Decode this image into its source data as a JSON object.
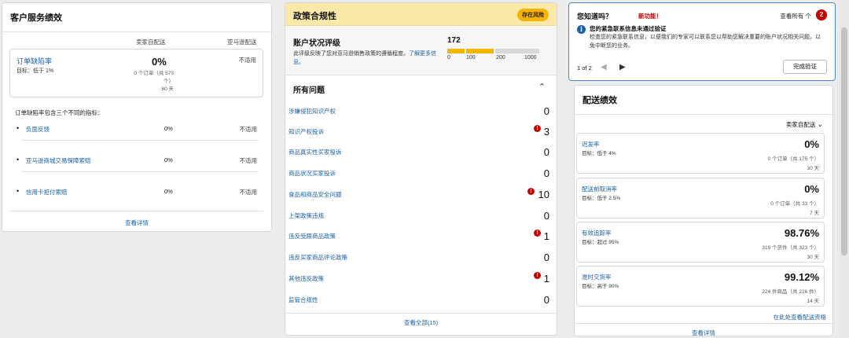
{
  "customer_service": {
    "title": "客户服务绩效",
    "col_seller": "卖家自配送",
    "col_amazon": "亚马逊配送",
    "odr": {
      "name": "订单缺陷率",
      "target": "目标：低于 1%",
      "value": "0%",
      "sub_line1": "0 个订单（共 573",
      "sub_line2": "个）",
      "days": "60 天",
      "amazon": "不适用"
    },
    "note": "订单缺陷率包含三个不同的指标：",
    "metrics": [
      {
        "name": "负面反馈",
        "value": "0%",
        "amazon": "不适用"
      },
      {
        "name": "亚马逊商城交易保障索赔",
        "value": "0%",
        "amazon": "不适用"
      },
      {
        "name": "信用卡拒付索赔",
        "value": "0%",
        "amazon": "不适用"
      }
    ],
    "view_details": "查看详情"
  },
  "policy": {
    "title": "政策合规性",
    "badge": "存在风险",
    "ahr_title": "账户状况评级",
    "ahr_desc": "此评级反映了您对亚马逊销售政策的遵循程度。",
    "ahr_link": "了解更多信息。",
    "score": "172",
    "ticks": [
      "0",
      "100",
      "200",
      "1000"
    ],
    "issues_title": "所有问题",
    "issues": [
      {
        "name": "涉嫌侵犯知识产权",
        "count": "0",
        "alert": false
      },
      {
        "name": "知识产权投诉",
        "count": "3",
        "alert": true
      },
      {
        "name": "商品真实性买家投诉",
        "count": "0",
        "alert": false
      },
      {
        "name": "商品状况买家投诉",
        "count": "0",
        "alert": false
      },
      {
        "name": "食品和商品安全问题",
        "count": "10",
        "alert": true
      },
      {
        "name": "上架政策违规",
        "count": "0",
        "alert": false
      },
      {
        "name": "违反受限商品政策",
        "count": "1",
        "alert": true
      },
      {
        "name": "违反买家商品评论政策",
        "count": "0",
        "alert": false
      },
      {
        "name": "其他违反政策",
        "count": "1",
        "alert": true
      },
      {
        "name": "监管合规性",
        "count": "0",
        "alert": false
      }
    ],
    "view_all": "查看全部(15)"
  },
  "dyk": {
    "title": "您知道吗？",
    "new": "新功能！",
    "view_all": "查看所有 个",
    "badge": "2",
    "head": "您的紧急联系信息未通过验证",
    "body": "检查您的紧急联系信息，以便我们的专家可以联系您以帮助您解决重要的账户状况相关问题，以免中断您的业务。",
    "pager": "1 of 2",
    "button": "完成验证"
  },
  "delivery": {
    "title": "配送绩效",
    "dropdown": "卖家自配送",
    "metrics": [
      {
        "name": "迟发率",
        "target": "目标：低于 4%",
        "value": "0%",
        "sub": "0 个订单（共 175 个）",
        "days": "30 天"
      },
      {
        "name": "配送前取消率",
        "target": "目标：低于 2.5%",
        "value": "0%",
        "sub": "0 个订单（共 33 个）",
        "days": "7 天"
      },
      {
        "name": "有效追踪率",
        "target": "目标：超过 95%",
        "value": "98.76%",
        "sub": "319 个货件（共 323 个）",
        "days": "30 天"
      },
      {
        "name": "准时交货率",
        "target": "目标：高于 90%",
        "value": "99.12%",
        "sub": "224 件商品（共 226 件）",
        "days": "14 天"
      }
    ],
    "view_here": "在此处查看配送资格",
    "view_details": "查看详情"
  }
}
